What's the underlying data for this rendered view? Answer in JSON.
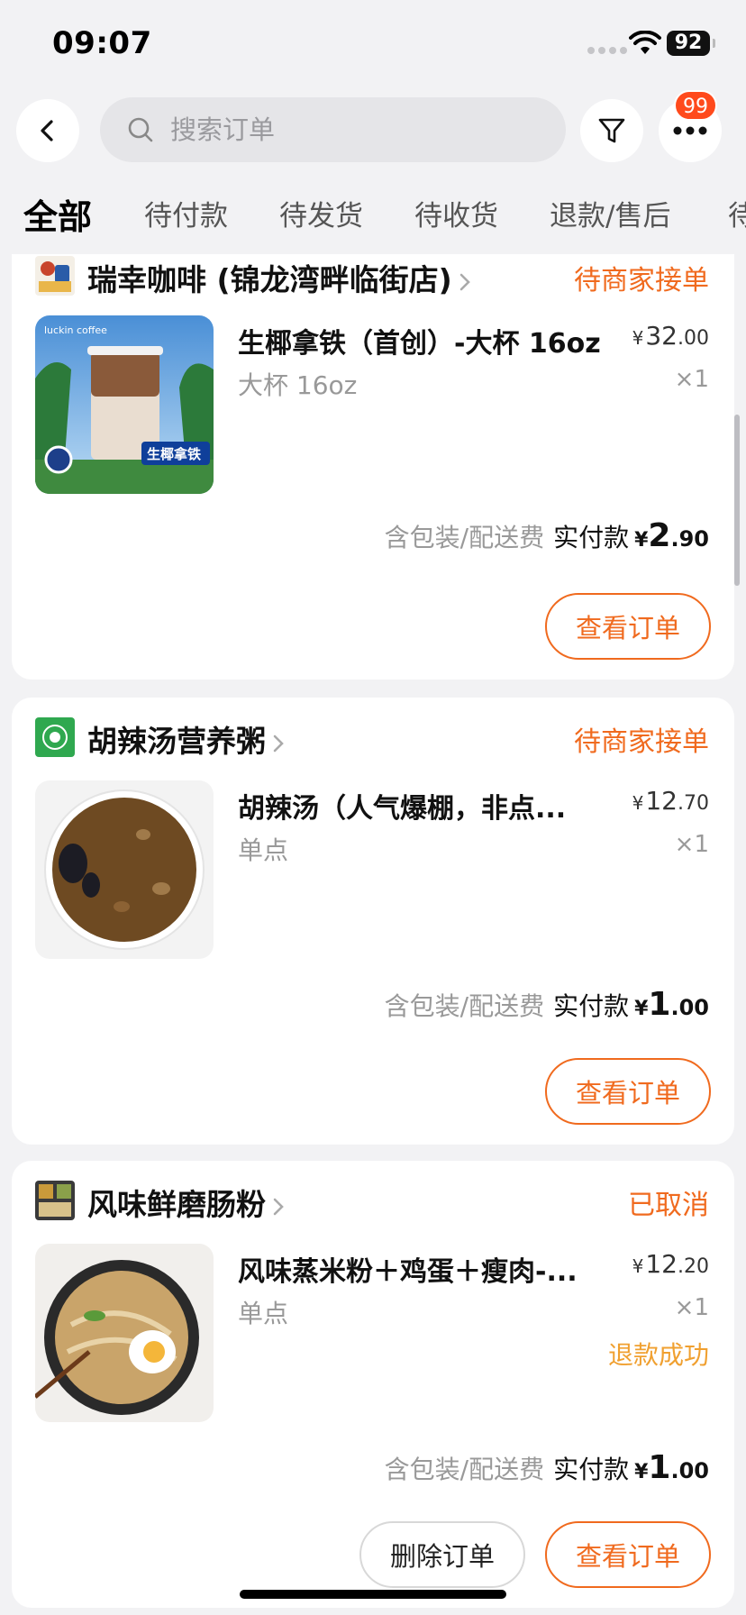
{
  "status_bar": {
    "time": "09:07",
    "battery": "92"
  },
  "search": {
    "placeholder": "搜索订单"
  },
  "more_badge": "99",
  "tabs": [
    "全部",
    "待付款",
    "待发货",
    "待收货",
    "退款/售后",
    "待"
  ],
  "orders": [
    {
      "shop": "瑞幸咖啡 (锦龙湾畔临街店)",
      "status": "待商家接单",
      "item_name": "生椰拿铁（首创）-大杯 16oz",
      "item_spec": "大杯 16oz",
      "price_yen": "¥",
      "price_int": "32",
      "price_dec": ".00",
      "qty": "×1",
      "fee_note": "含包装/配送费",
      "paid_label": "实付款",
      "paid_yen": "¥",
      "paid_int": "2",
      "paid_dec": ".90",
      "view_btn": "查看订单",
      "thumb_brand": "luckin coffee",
      "thumb_caption": "生椰拿铁"
    },
    {
      "shop": "胡辣汤营养粥",
      "status": "待商家接单",
      "item_name": "胡辣汤（人气爆棚，非点...",
      "item_spec": "单点",
      "price_yen": "¥",
      "price_int": "12",
      "price_dec": ".70",
      "qty": "×1",
      "fee_note": "含包装/配送费",
      "paid_label": "实付款",
      "paid_yen": "¥",
      "paid_int": "1",
      "paid_dec": ".00",
      "view_btn": "查看订单"
    },
    {
      "shop": "风味鲜磨肠粉",
      "status": "已取消",
      "item_name": "风味蒸米粉＋鸡蛋＋瘦肉-...",
      "item_spec": "单点",
      "price_yen": "¥",
      "price_int": "12",
      "price_dec": ".20",
      "qty": "×1",
      "refund": "退款成功",
      "fee_note": "含包装/配送费",
      "paid_label": "实付款",
      "paid_yen": "¥",
      "paid_int": "1",
      "paid_dec": ".00",
      "delete_btn": "删除订单",
      "view_btn": "查看订单"
    }
  ],
  "colors": {
    "accent": "#f06a1e",
    "refund": "#f0a030",
    "badge": "#ff4a1c"
  }
}
